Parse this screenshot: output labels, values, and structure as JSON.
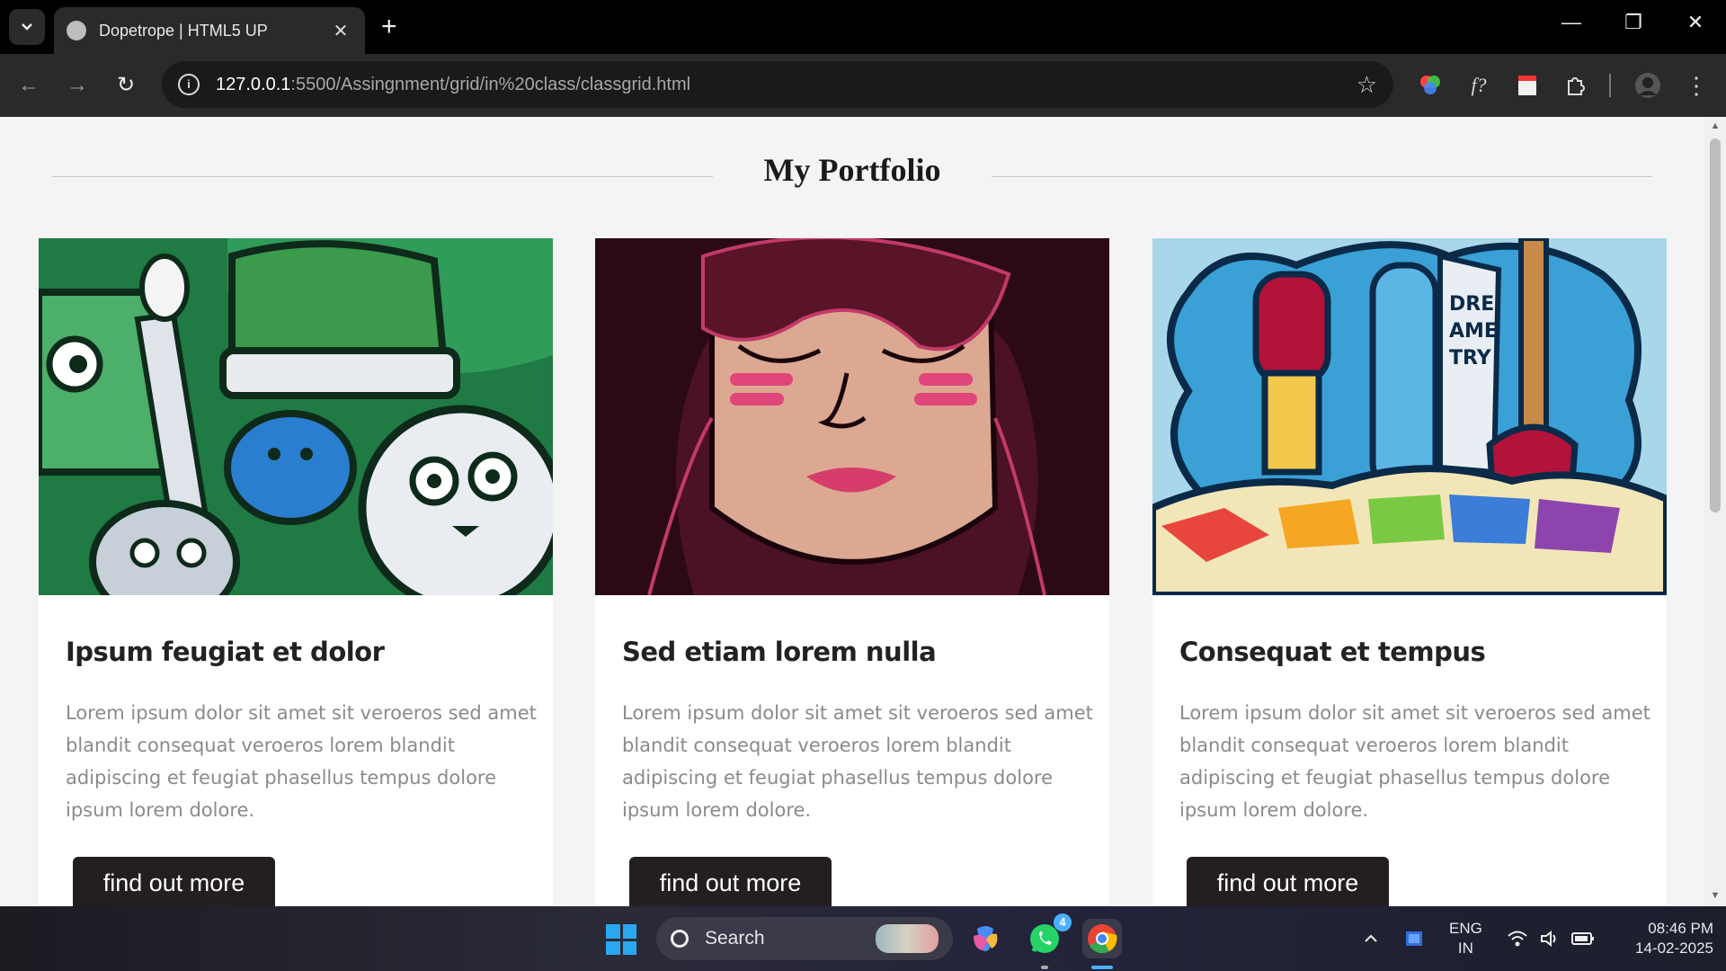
{
  "browser": {
    "tab_title": "Dopetrope | HTML5 UP",
    "url_host": "127.0.0.1",
    "url_path": ":5500/Assingnment/grid/in%20class/classgrid.html"
  },
  "page": {
    "heading": "My Portfolio",
    "cards": [
      {
        "title": "Ipsum feugiat et dolor",
        "text": "Lorem ipsum dolor sit amet sit veroeros sed amet blandit consequat veroeros lorem blandit adipiscing et feugiat phasellus tempus dolore ipsum lorem dolore.",
        "button": "find out more"
      },
      {
        "title": "Sed etiam lorem nulla",
        "text": "Lorem ipsum dolor sit amet sit veroeros sed amet blandit consequat veroeros lorem blandit adipiscing et feugiat phasellus tempus dolore ipsum lorem dolore.",
        "button": "find out more"
      },
      {
        "title": "Consequat et tempus",
        "text": "Lorem ipsum dolor sit amet sit veroeros sed amet blandit consequat veroeros lorem blandit adipiscing et feugiat phasellus tempus dolore ipsum lorem dolore.",
        "button": "find out more"
      }
    ]
  },
  "taskbar": {
    "search_label": "Search",
    "whatsapp_badge": "4",
    "lang_top": "ENG",
    "lang_bottom": "IN",
    "time": "08:46 PM",
    "date": "14-02-2025"
  }
}
